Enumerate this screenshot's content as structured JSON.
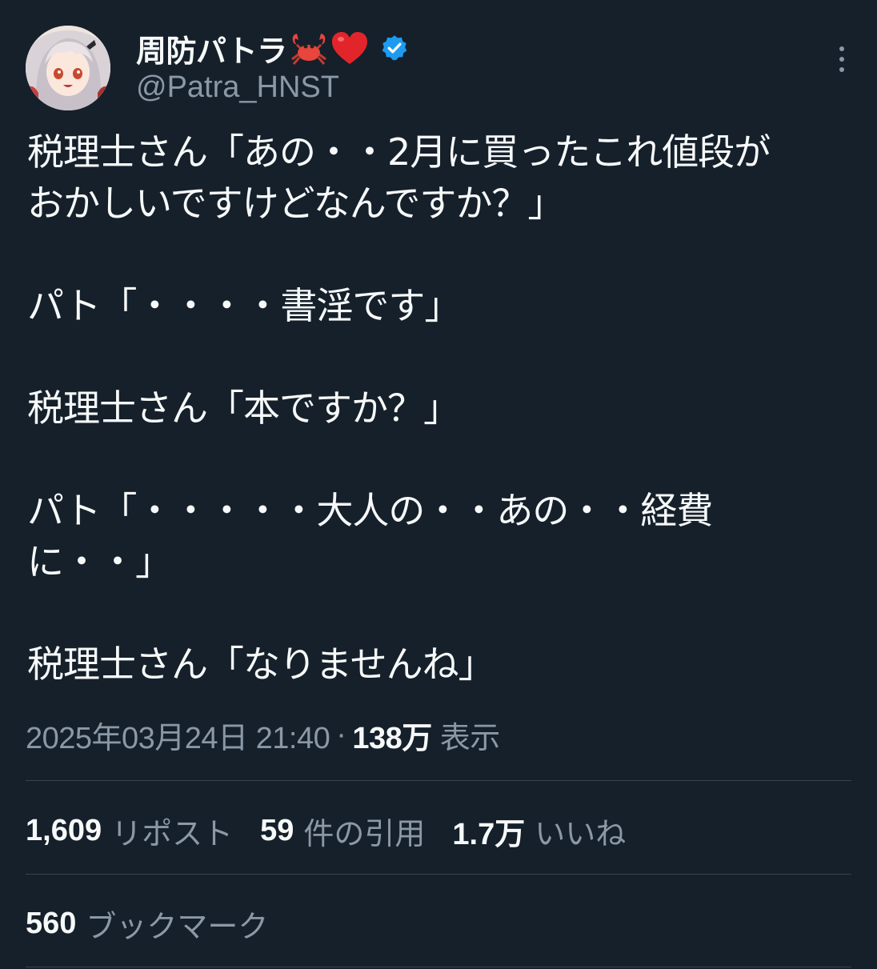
{
  "author": {
    "display_name": "周防パトラ",
    "handle": "@Patra_HNST",
    "badges": [
      "crab-emoji",
      "red-heart-emoji",
      "verified-badge"
    ],
    "verified_color": "#1d9bf0"
  },
  "tweet": {
    "paragraphs": [
      [
        "税理士さん「あの・・2月に買ったこれ値段が",
        "おかしいですけどなんですか？」"
      ],
      [
        "パト「・・・・書淫です」"
      ],
      [
        "税理士さん「本ですか？」"
      ],
      [
        "パト「・・・・・大人の・・あの・・経費",
        "に・・」"
      ],
      [
        "税理士さん「なりませんね」"
      ]
    ]
  },
  "meta": {
    "timestamp": "2025年03月24日 21:40",
    "separator": "·",
    "views_count": "138万",
    "views_label": "表示"
  },
  "stats": {
    "reposts": {
      "count": "1,609",
      "label": "リポスト"
    },
    "quotes": {
      "count": "59",
      "label": "件の引用"
    },
    "likes": {
      "count": "1.7万",
      "label": "いいね"
    },
    "bookmarks": {
      "count": "560",
      "label": "ブックマーク"
    }
  },
  "colors": {
    "background": "#15202b",
    "text": "#f7f9f9",
    "secondary": "#8b98a5",
    "divider": "#38444d"
  }
}
